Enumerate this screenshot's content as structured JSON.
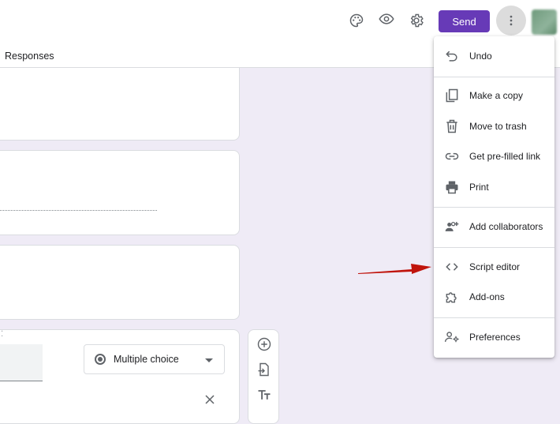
{
  "header": {
    "send_label": "Send",
    "tab_responses": "Responses"
  },
  "question_card": {
    "type_label": "Multiple choice"
  },
  "menu": {
    "items": [
      {
        "label": "Undo",
        "icon": "undo-icon"
      },
      {
        "label": "Make a copy",
        "icon": "copy-icon"
      },
      {
        "label": "Move to trash",
        "icon": "trash-icon"
      },
      {
        "label": "Get pre-filled link",
        "icon": "link-icon"
      },
      {
        "label": "Print",
        "icon": "print-icon"
      },
      {
        "label": "Add collaborators",
        "icon": "add-collaborators-icon"
      },
      {
        "label": "Script editor",
        "icon": "code-icon"
      },
      {
        "label": "Add-ons",
        "icon": "puzzle-icon"
      },
      {
        "label": "Preferences",
        "icon": "preferences-icon"
      }
    ]
  },
  "colors": {
    "accent": "#673ab7",
    "background": "#efebf6",
    "annotation_arrow": "#c0140c"
  }
}
